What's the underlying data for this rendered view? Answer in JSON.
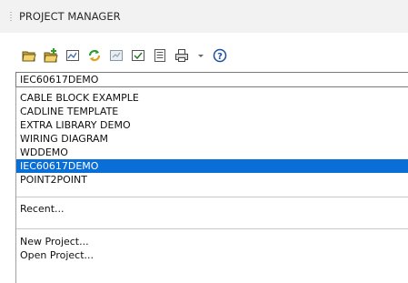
{
  "panel": {
    "title": "PROJECT MANAGER"
  },
  "toolbar": {
    "icons": [
      "open-project-icon",
      "new-project-icon",
      "project-properties-icon",
      "refresh-icon",
      "update-icon",
      "check-icon",
      "report-icon",
      "print-icon",
      "dropdown-arrow-icon",
      "help-icon"
    ]
  },
  "combo": {
    "value": "IEC60617DEMO"
  },
  "list": {
    "projects": [
      "CABLE BLOCK EXAMPLE",
      "CADLINE TEMPLATE",
      "EXTRA LIBRARY DEMO",
      "WIRING DIAGRAM",
      "WDDEMO",
      "IEC60617DEMO",
      "POINT2POINT"
    ],
    "selected": "IEC60617DEMO",
    "recent": "Recent...",
    "new_project": "New Project...",
    "open_project": "Open Project..."
  }
}
